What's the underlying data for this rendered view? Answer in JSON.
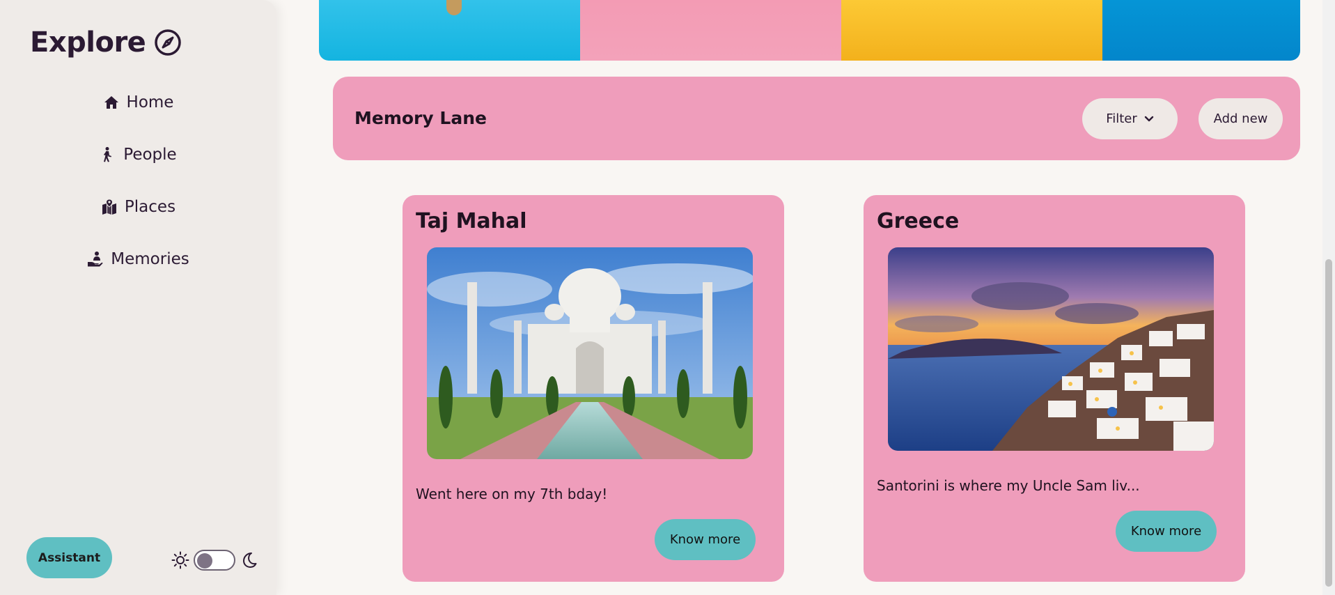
{
  "sidebar": {
    "brand": "Explore",
    "brand_icon": "compass-icon",
    "items": [
      {
        "label": "Home",
        "icon": "home-icon"
      },
      {
        "label": "People",
        "icon": "person-walking-icon"
      },
      {
        "label": "Places",
        "icon": "map-location-icon"
      },
      {
        "label": "Memories",
        "icon": "hand-holding-person-icon"
      }
    ],
    "assistant_label": "Assistant",
    "theme": {
      "light_icon": "sun-icon",
      "dark_icon": "moon-icon",
      "dark_mode": false
    }
  },
  "header": {
    "title": "Memory Lane",
    "filter_label": "Filter",
    "add_label": "Add new"
  },
  "cards": [
    {
      "title": "Taj Mahal",
      "description": "Went here on my 7th bday!",
      "button": "Know more"
    },
    {
      "title": "Greece",
      "description": "Santorini is where my Uncle Sam liv...",
      "button": "Know more"
    }
  ],
  "colors": {
    "accent_pink": "#ef9dbb",
    "accent_teal": "#5fbfc2",
    "sidebar_bg": "#efebe8",
    "page_bg": "#f9f6f3"
  }
}
